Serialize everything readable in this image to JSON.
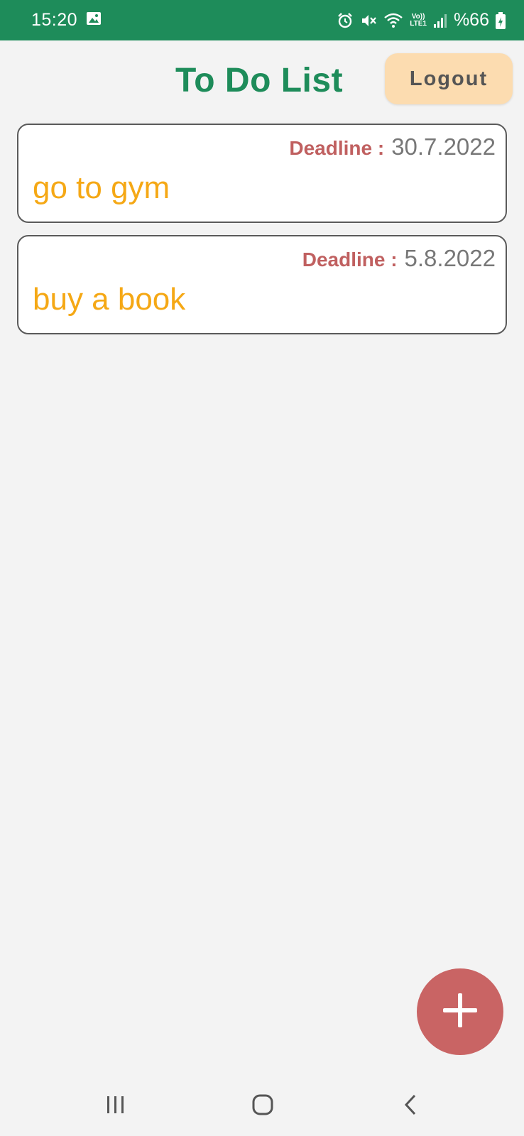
{
  "status_bar": {
    "time": "15:20",
    "network_label_top": "Vo))",
    "network_label_bottom": "LTE1",
    "battery": "%66",
    "icons": [
      "gallery-icon",
      "alarm-icon",
      "mute-icon",
      "wifi-icon",
      "signal-icon",
      "battery-icon"
    ]
  },
  "header": {
    "title": "To Do List",
    "logout_label": "Logout"
  },
  "tasks": [
    {
      "deadline_label": "Deadline :",
      "deadline": "30.7.2022",
      "title": "go to gym"
    },
    {
      "deadline_label": "Deadline :",
      "deadline": "5.8.2022",
      "title": "buy a book"
    }
  ],
  "fab": {
    "icon": "plus-icon"
  },
  "nav_bar": {
    "icons": [
      "recent-apps-icon",
      "home-icon",
      "back-icon"
    ]
  },
  "colors": {
    "primary": "#1e8c5a",
    "logout_bg": "#fcdcb0",
    "deadline_label": "#c06060",
    "task_title": "#f5a815",
    "fab": "#c96464",
    "background": "#f3f3f3"
  }
}
